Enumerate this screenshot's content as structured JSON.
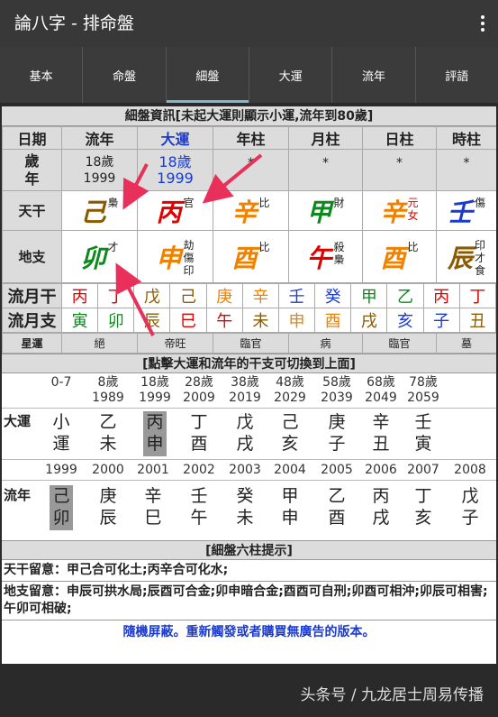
{
  "app_title": "論八字 - 排命盤",
  "tabs": [
    "基本",
    "命盤",
    "細盤",
    "大運",
    "流年",
    "評語"
  ],
  "active_tab": "細盤",
  "header1": "細盤資訊[未起大運則顯示小運,流年到80歲]",
  "columns": [
    "日期",
    "流年",
    "大運",
    "年柱",
    "月柱",
    "日柱",
    "時柱"
  ],
  "age_label": "歲年",
  "age_row": [
    [
      "18歲",
      "1999"
    ],
    [
      "18歲",
      "1999"
    ],
    [
      "*",
      ""
    ],
    [
      "*",
      ""
    ],
    [
      "*",
      ""
    ],
    [
      "*",
      ""
    ]
  ],
  "tiangan_label": "天干",
  "tiangan": [
    {
      "ch": "己",
      "color": "#8b5a00",
      "tag": [
        "梟"
      ]
    },
    {
      "ch": "丙",
      "color": "#e00000",
      "tag": [
        "官"
      ]
    },
    {
      "ch": "辛",
      "color": "#f08000",
      "tag": [
        "比"
      ]
    },
    {
      "ch": "甲",
      "color": "#0a8a1a",
      "tag": [
        "財"
      ]
    },
    {
      "ch": "辛",
      "color": "#f08000",
      "tag": [
        "元",
        "女"
      ],
      "tagcolor": "#e00000"
    },
    {
      "ch": "壬",
      "color": "#1a3bd1",
      "tag": [
        "傷"
      ]
    }
  ],
  "dizhi_label": "地支",
  "dizhi": [
    {
      "ch": "卯",
      "color": "#0a8a1a",
      "tag": [
        "才"
      ]
    },
    {
      "ch": "申",
      "color": "#f08000",
      "tag": [
        "劫",
        "傷",
        "印"
      ]
    },
    {
      "ch": "酉",
      "color": "#f08000",
      "tag": [
        "比"
      ]
    },
    {
      "ch": "午",
      "color": "#e00000",
      "tag": [
        "殺",
        "梟"
      ]
    },
    {
      "ch": "酉",
      "color": "#f08000",
      "tag": [
        "比"
      ]
    },
    {
      "ch": "辰",
      "color": "#8b5a00",
      "tag": [
        "印",
        "才",
        "食"
      ]
    }
  ],
  "liuyuegan_label": "流月干",
  "liuyuegan": [
    {
      "c": "丙",
      "k": "#e00000"
    },
    {
      "c": "丁",
      "k": "#e00000"
    },
    {
      "c": "戊",
      "k": "#8b5a00"
    },
    {
      "c": "己",
      "k": "#8b5a00"
    },
    {
      "c": "庚",
      "k": "#f08000"
    },
    {
      "c": "辛",
      "k": "#f08000"
    },
    {
      "c": "壬",
      "k": "#1a3bd1"
    },
    {
      "c": "癸",
      "k": "#1a3bd1"
    },
    {
      "c": "甲",
      "k": "#0a8a1a"
    },
    {
      "c": "乙",
      "k": "#0a8a1a"
    },
    {
      "c": "丙",
      "k": "#e00000"
    },
    {
      "c": "丁",
      "k": "#e00000"
    }
  ],
  "liuyuezhi_label": "流月支",
  "liuyuezhi": [
    {
      "c": "寅",
      "k": "#0a8a1a"
    },
    {
      "c": "卯",
      "k": "#0a8a1a"
    },
    {
      "c": "辰",
      "k": "#8b5a00"
    },
    {
      "c": "巳",
      "k": "#e00000"
    },
    {
      "c": "午",
      "k": "#e00000"
    },
    {
      "c": "未",
      "k": "#8b5a00"
    },
    {
      "c": "申",
      "k": "#f08000"
    },
    {
      "c": "酉",
      "k": "#f08000"
    },
    {
      "c": "戌",
      "k": "#8b5a00"
    },
    {
      "c": "亥",
      "k": "#1a3bd1"
    },
    {
      "c": "子",
      "k": "#1a3bd1"
    },
    {
      "c": "丑",
      "k": "#8b5a00"
    }
  ],
  "xingyun_label": "星運",
  "xingyun": [
    "絕",
    "帝旺",
    "臨官",
    "病",
    "臨官",
    "墓"
  ],
  "header2": "[點擊大運和流年的干支可切換到上面]",
  "dayun_label": "大運",
  "dayun": [
    {
      "age": "0-7",
      "year": "",
      "g": "小",
      "z": "運"
    },
    {
      "age": "8歲",
      "year": "1989",
      "g": "乙",
      "z": "未"
    },
    {
      "age": "18歲",
      "year": "1999",
      "g": "丙",
      "z": "申"
    },
    {
      "age": "28歲",
      "year": "2009",
      "g": "丁",
      "z": "酉"
    },
    {
      "age": "38歲",
      "year": "2019",
      "g": "戊",
      "z": "戌"
    },
    {
      "age": "48歲",
      "year": "2029",
      "g": "己",
      "z": "亥"
    },
    {
      "age": "58歲",
      "year": "2039",
      "g": "庚",
      "z": "子"
    },
    {
      "age": "68歲",
      "year": "2049",
      "g": "辛",
      "z": "丑"
    },
    {
      "age": "78歲",
      "year": "2059",
      "g": "壬",
      "z": "寅"
    }
  ],
  "liunian_label": "流年",
  "liunian": [
    {
      "year": "1999",
      "g": "己",
      "z": "卯"
    },
    {
      "year": "2000",
      "g": "庚",
      "z": "辰"
    },
    {
      "year": "2001",
      "g": "辛",
      "z": "巳"
    },
    {
      "year": "2002",
      "g": "壬",
      "z": "午"
    },
    {
      "year": "2003",
      "g": "癸",
      "z": "未"
    },
    {
      "year": "2004",
      "g": "甲",
      "z": "申"
    },
    {
      "year": "2005",
      "g": "乙",
      "z": "酉"
    },
    {
      "year": "2006",
      "g": "丙",
      "z": "戌"
    },
    {
      "year": "2007",
      "g": "丁",
      "z": "亥"
    },
    {
      "year": "2008",
      "g": "戊",
      "z": "子"
    }
  ],
  "header3": "[細盤六柱提示]",
  "note1": "天干留意：甲己合可化土;丙辛合可化水;",
  "note2": "地支留意：申辰可拱水局;辰酉可合金;卯申暗合金;酉酉可自刑;卯酉可相沖;卯辰可相害;午卯可相破;",
  "ad_text": "隨機屏蔽。重新觸發或者購買無廣告的版本。",
  "watermark": "头条号 / 九龙居士周易传播",
  "colors": {
    "dayun_header": "#1a3bd1",
    "arrow": "#e8305a",
    "highlight": "#999999"
  }
}
